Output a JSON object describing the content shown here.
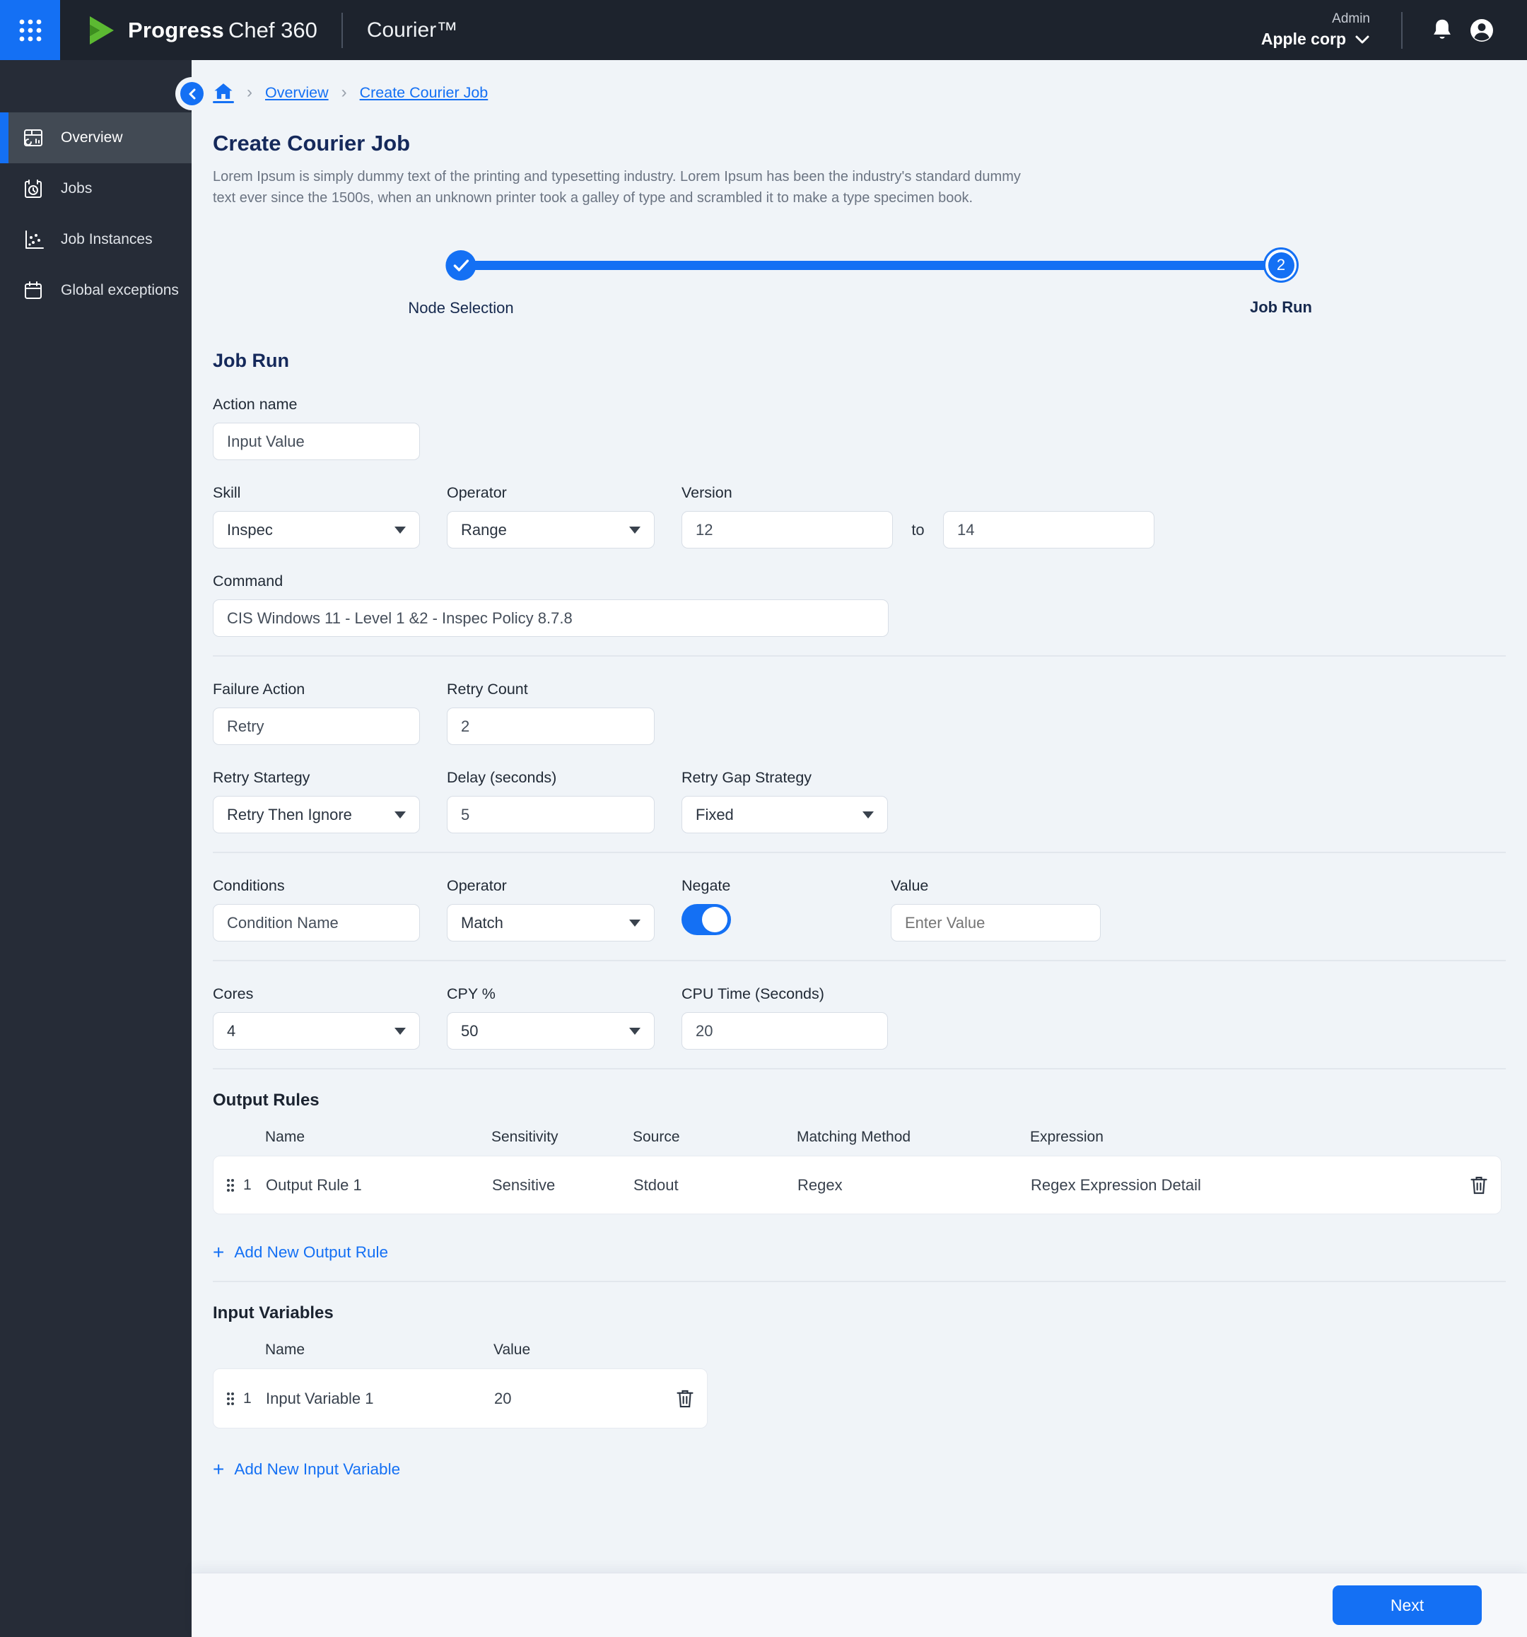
{
  "header": {
    "brand_bold": "Progress",
    "brand_light": "Chef 360",
    "product": "Courier™",
    "role_label": "Admin",
    "org_name": "Apple corp"
  },
  "sidebar": {
    "items": [
      {
        "label": "Overview",
        "active": true
      },
      {
        "label": "Jobs",
        "active": false
      },
      {
        "label": "Job Instances",
        "active": false
      },
      {
        "label": "Global exceptions",
        "active": false
      }
    ]
  },
  "breadcrumb": {
    "items": [
      {
        "label": "Overview"
      },
      {
        "label": "Create Courier Job"
      }
    ]
  },
  "page": {
    "title": "Create Courier Job",
    "description": "Lorem Ipsum is simply dummy text of the printing and typesetting industry. Lorem Ipsum has been the industry's standard dummy text ever since the 1500s, when an unknown printer took a galley of type and scrambled it to make a type specimen book."
  },
  "stepper": {
    "steps": [
      {
        "label": "Node Selection",
        "state": "complete"
      },
      {
        "label": "Job Run",
        "state": "active",
        "number": "2"
      }
    ]
  },
  "form": {
    "section_title": "Job Run",
    "action_name": {
      "label": "Action name",
      "value": "Input Value"
    },
    "skill": {
      "label": "Skill",
      "value": "Inspec"
    },
    "operator": {
      "label": "Operator",
      "value": "Range"
    },
    "version": {
      "label": "Version",
      "from": "12",
      "to_label": "to",
      "to": "14"
    },
    "command": {
      "label": "Command",
      "value": "CIS Windows 11 - Level 1 &2 - Inspec Policy 8.7.8"
    },
    "failure_action": {
      "label": "Failure Action",
      "value": "Retry"
    },
    "retry_count": {
      "label": "Retry Count",
      "value": "2"
    },
    "retry_strategy": {
      "label": "Retry Startegy",
      "value": "Retry Then Ignore"
    },
    "delay": {
      "label": "Delay (seconds)",
      "value": "5"
    },
    "retry_gap": {
      "label": "Retry Gap Strategy",
      "value": "Fixed"
    },
    "conditions": {
      "label": "Conditions",
      "value": "Condition Name"
    },
    "cond_operator": {
      "label": "Operator",
      "value": "Match"
    },
    "negate": {
      "label": "Negate",
      "on": true
    },
    "value_field": {
      "label": "Value",
      "placeholder": "Enter Value"
    },
    "cores": {
      "label": "Cores",
      "value": "4"
    },
    "cpy": {
      "label": "CPY %",
      "value": "50"
    },
    "cpu_time": {
      "label": "CPU Time (Seconds)",
      "value": "20"
    }
  },
  "output_rules": {
    "title": "Output Rules",
    "columns": {
      "name": "Name",
      "sensitivity": "Sensitivity",
      "source": "Source",
      "matching_method": "Matching Method",
      "expression": "Expression"
    },
    "rows": [
      {
        "index": "1",
        "name": "Output Rule 1",
        "sensitivity": "Sensitive",
        "source": "Stdout",
        "matching_method": "Regex",
        "expression": "Regex Expression Detail"
      }
    ],
    "add_label": "Add New Output Rule",
    "add_plus": "+"
  },
  "input_variables": {
    "title": "Input Variables",
    "columns": {
      "name": "Name",
      "value": "Value"
    },
    "rows": [
      {
        "index": "1",
        "name": "Input Variable 1",
        "value": "20"
      }
    ],
    "add_label": "Add New Input Variable",
    "add_plus": "+"
  },
  "footer": {
    "next_label": "Next"
  },
  "colors": {
    "accent": "#1470f4",
    "header_bg": "#1d232d",
    "sidebar_bg": "#262c37",
    "navy_text": "#15295b",
    "content_bg": "#f0f4f8"
  }
}
